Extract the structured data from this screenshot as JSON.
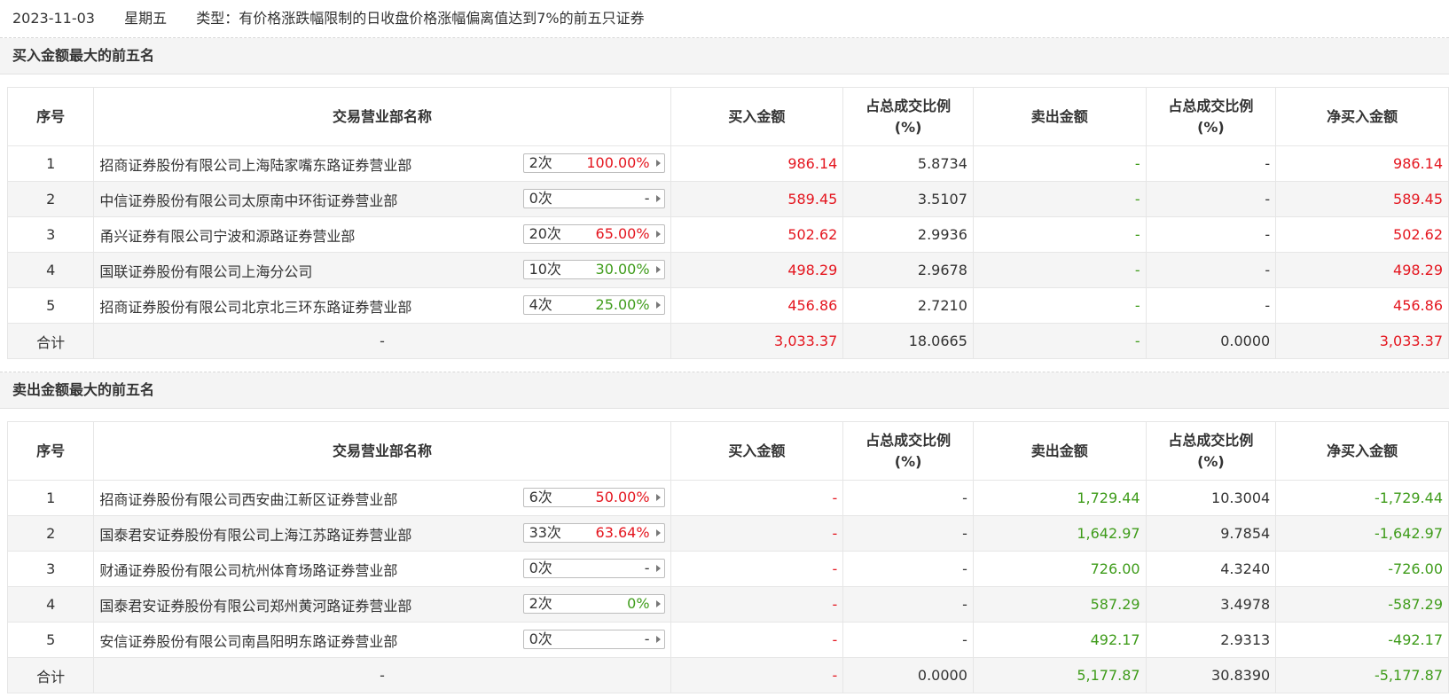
{
  "header": {
    "date": "2023-11-03",
    "weekday": "星期五",
    "type_text": "类型：有价格涨跌幅限制的日收盘价格涨幅偏离值达到7%的前五只证券"
  },
  "buy_section": {
    "title": "买入金额最大的前五名",
    "columns": [
      "序号",
      "交易营业部名称",
      "买入金额",
      "占总成交比例(%)",
      "卖出金额",
      "占总成交比例(%)",
      "净买入金额"
    ],
    "rows": [
      {
        "idx": "1",
        "name": "招商证券股份有限公司上海陆家嘴东路证券营业部",
        "times": "2次",
        "rate": "100.00%",
        "rate_color": "red",
        "buy": "986.14",
        "buy_pct": "5.8734",
        "sell": "-",
        "sell_pct": "-",
        "net": "986.14"
      },
      {
        "idx": "2",
        "name": "中信证券股份有限公司太原南中环街证券营业部",
        "times": "0次",
        "rate": "-",
        "rate_color": "black",
        "buy": "589.45",
        "buy_pct": "3.5107",
        "sell": "-",
        "sell_pct": "-",
        "net": "589.45"
      },
      {
        "idx": "3",
        "name": "甬兴证券有限公司宁波和源路证券营业部",
        "times": "20次",
        "rate": "65.00%",
        "rate_color": "red",
        "buy": "502.62",
        "buy_pct": "2.9936",
        "sell": "-",
        "sell_pct": "-",
        "net": "502.62"
      },
      {
        "idx": "4",
        "name": "国联证券股份有限公司上海分公司",
        "times": "10次",
        "rate": "30.00%",
        "rate_color": "green",
        "buy": "498.29",
        "buy_pct": "2.9678",
        "sell": "-",
        "sell_pct": "-",
        "net": "498.29"
      },
      {
        "idx": "5",
        "name": "招商证券股份有限公司北京北三环东路证券营业部",
        "times": "4次",
        "rate": "25.00%",
        "rate_color": "green",
        "buy": "456.86",
        "buy_pct": "2.7210",
        "sell": "-",
        "sell_pct": "-",
        "net": "456.86"
      }
    ],
    "total": {
      "label": "合计",
      "name": "-",
      "buy": "3,033.37",
      "buy_pct": "18.0665",
      "sell": "-",
      "sell_pct": "0.0000",
      "net": "3,033.37"
    }
  },
  "sell_section": {
    "title": "卖出金额最大的前五名",
    "columns": [
      "序号",
      "交易营业部名称",
      "买入金额",
      "占总成交比例(%)",
      "卖出金额",
      "占总成交比例(%)",
      "净买入金额"
    ],
    "rows": [
      {
        "idx": "1",
        "name": "招商证券股份有限公司西安曲江新区证券营业部",
        "times": "6次",
        "rate": "50.00%",
        "rate_color": "red",
        "buy": "-",
        "buy_pct": "-",
        "sell": "1,729.44",
        "sell_pct": "10.3004",
        "net": "-1,729.44"
      },
      {
        "idx": "2",
        "name": "国泰君安证券股份有限公司上海江苏路证券营业部",
        "times": "33次",
        "rate": "63.64%",
        "rate_color": "red",
        "buy": "-",
        "buy_pct": "-",
        "sell": "1,642.97",
        "sell_pct": "9.7854",
        "net": "-1,642.97"
      },
      {
        "idx": "3",
        "name": "财通证券股份有限公司杭州体育场路证券营业部",
        "times": "0次",
        "rate": "-",
        "rate_color": "black",
        "buy": "-",
        "buy_pct": "-",
        "sell": "726.00",
        "sell_pct": "4.3240",
        "net": "-726.00"
      },
      {
        "idx": "4",
        "name": "国泰君安证券股份有限公司郑州黄河路证券营业部",
        "times": "2次",
        "rate": "0%",
        "rate_color": "green",
        "buy": "-",
        "buy_pct": "-",
        "sell": "587.29",
        "sell_pct": "3.4978",
        "net": "-587.29"
      },
      {
        "idx": "5",
        "name": "安信证券股份有限公司南昌阳明东路证券营业部",
        "times": "0次",
        "rate": "-",
        "rate_color": "black",
        "buy": "-",
        "buy_pct": "-",
        "sell": "492.17",
        "sell_pct": "2.9313",
        "net": "-492.17"
      }
    ],
    "total": {
      "label": "合计",
      "name": "-",
      "buy": "-",
      "buy_pct": "0.0000",
      "sell": "5,177.87",
      "sell_pct": "30.8390",
      "net": "-5,177.87"
    }
  },
  "colors": {
    "red": "#e4161f",
    "green": "#3f9c1b",
    "black": "#333333"
  }
}
